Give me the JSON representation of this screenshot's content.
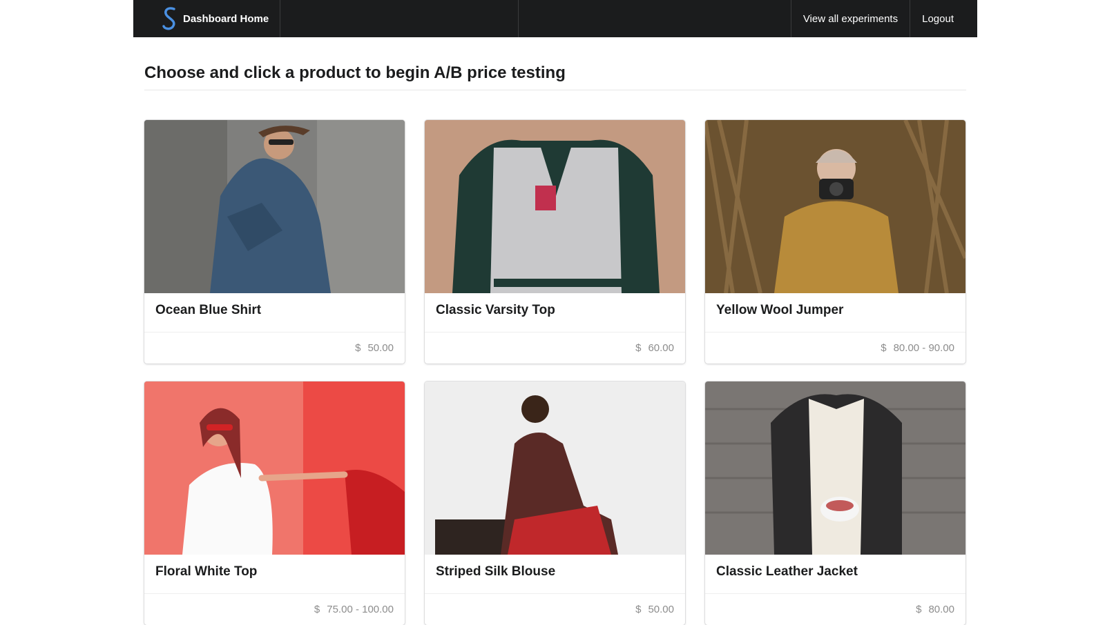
{
  "nav": {
    "brand": "Dashboard Home",
    "links": [
      "View all experiments",
      "Logout"
    ]
  },
  "header": {
    "title": "Choose and click a product to begin A/B price testing"
  },
  "currency_symbol": "$",
  "products": [
    {
      "name": "Ocean Blue Shirt",
      "price": "50.00"
    },
    {
      "name": "Classic Varsity Top",
      "price": "60.00"
    },
    {
      "name": "Yellow Wool Jumper",
      "price": "80.00 - 90.00"
    },
    {
      "name": "Floral White Top",
      "price": "75.00 - 100.00"
    },
    {
      "name": "Striped Silk Blouse",
      "price": "50.00"
    },
    {
      "name": "Classic Leather Jacket",
      "price": "80.00"
    }
  ],
  "colors": {
    "navbar": "#1b1c1d",
    "logo_accent": "#4a90e2",
    "price_text": "#8c8c8c"
  }
}
